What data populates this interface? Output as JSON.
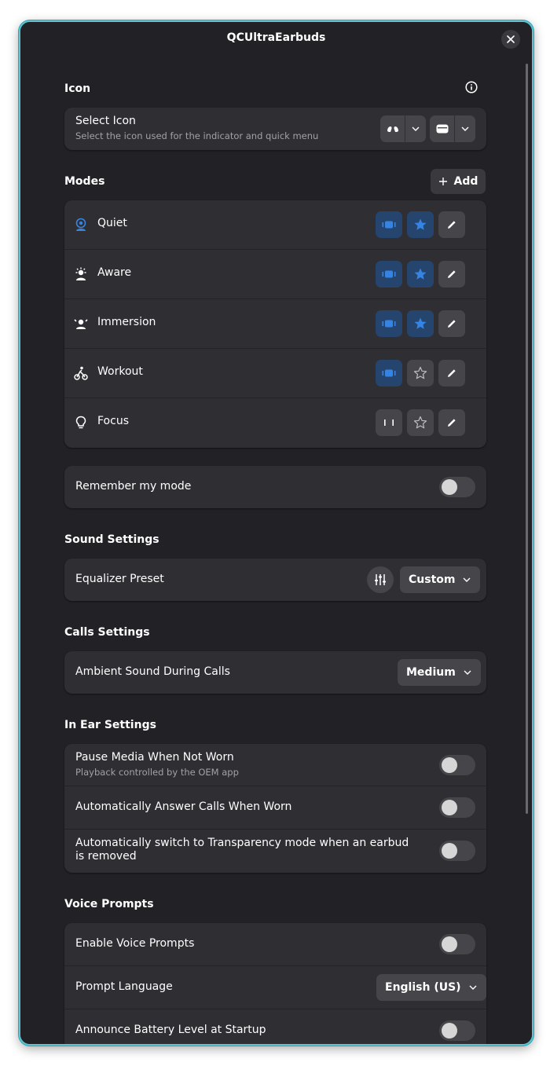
{
  "window": {
    "title": "QCUltraEarbuds"
  },
  "icon_section": {
    "title": "Icon",
    "select_label": "Select Icon",
    "select_sub": "Select the icon used for the indicator and quick menu"
  },
  "modes_section": {
    "title": "Modes",
    "add_label": "Add",
    "modes": [
      {
        "label": "Quiet",
        "icon": "quiet-mode-icon",
        "toggle_on": true,
        "favorite": true
      },
      {
        "label": "Aware",
        "icon": "aware-mode-icon",
        "toggle_on": true,
        "favorite": true
      },
      {
        "label": "Immersion",
        "icon": "immersion-mode-icon",
        "toggle_on": true,
        "favorite": true
      },
      {
        "label": "Workout",
        "icon": "workout-mode-icon",
        "toggle_on": true,
        "favorite": false
      },
      {
        "label": "Focus",
        "icon": "focus-mode-icon",
        "toggle_on": false,
        "favorite": false
      }
    ]
  },
  "remember_mode": {
    "label": "Remember my mode",
    "enabled": false
  },
  "sound_settings": {
    "title": "Sound Settings",
    "equalizer_label": "Equalizer Preset",
    "equalizer_value": "Custom"
  },
  "calls_settings": {
    "title": "Calls Settings",
    "ambient_label": "Ambient Sound During Calls",
    "ambient_value": "Medium"
  },
  "in_ear_settings": {
    "title": "In Ear Settings",
    "pause_label": "Pause Media When Not Worn",
    "pause_sub": "Playback controlled by the OEM app",
    "answer_label": "Automatically Answer Calls When Worn",
    "transparency_label": "Automatically switch to Transparency mode when an earbud is removed"
  },
  "voice_prompts": {
    "title": "Voice Prompts",
    "enable_label": "Enable Voice Prompts",
    "language_label": "Prompt Language",
    "language_value": "English (US)",
    "battery_label": "Announce Battery Level at Startup"
  },
  "colors": {
    "accent": "#3584e4",
    "accent_bg": "#26456e",
    "window_bg": "#222226",
    "card_bg": "#2f2f33",
    "border": "#5ec4d2"
  }
}
